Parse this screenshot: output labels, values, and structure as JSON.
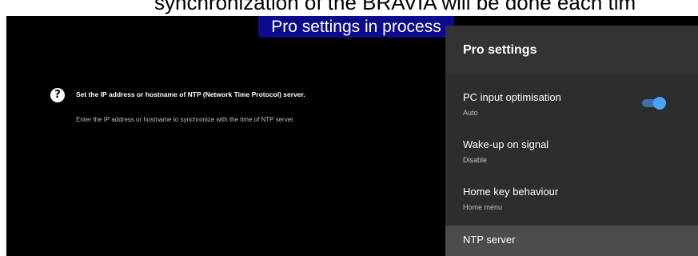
{
  "caption_top": "synchronization of the BRAVIA will be done each tim",
  "caption_banner": "Pro settings in process",
  "help": {
    "icon": "help-circle-icon",
    "title": "Set the IP address or hostname of NTP (Network Time Protocol) server.",
    "description": "Enter the IP address or hostname to synchronize with the time of NTP server."
  },
  "panel": {
    "title": "Pro settings",
    "items": [
      {
        "label": "PC input optimisation",
        "value": "Auto",
        "toggle_on": true
      },
      {
        "label": "Wake-up on signal",
        "value": "Disable"
      },
      {
        "label": "Home key behaviour",
        "value": "Home menu"
      },
      {
        "label": "NTP server",
        "value": ""
      }
    ]
  },
  "colors": {
    "toggle_thumb": "#4aa3ff",
    "toggle_track": "#3d6fa8",
    "caption_banner_bg": "#0b0b8c"
  }
}
